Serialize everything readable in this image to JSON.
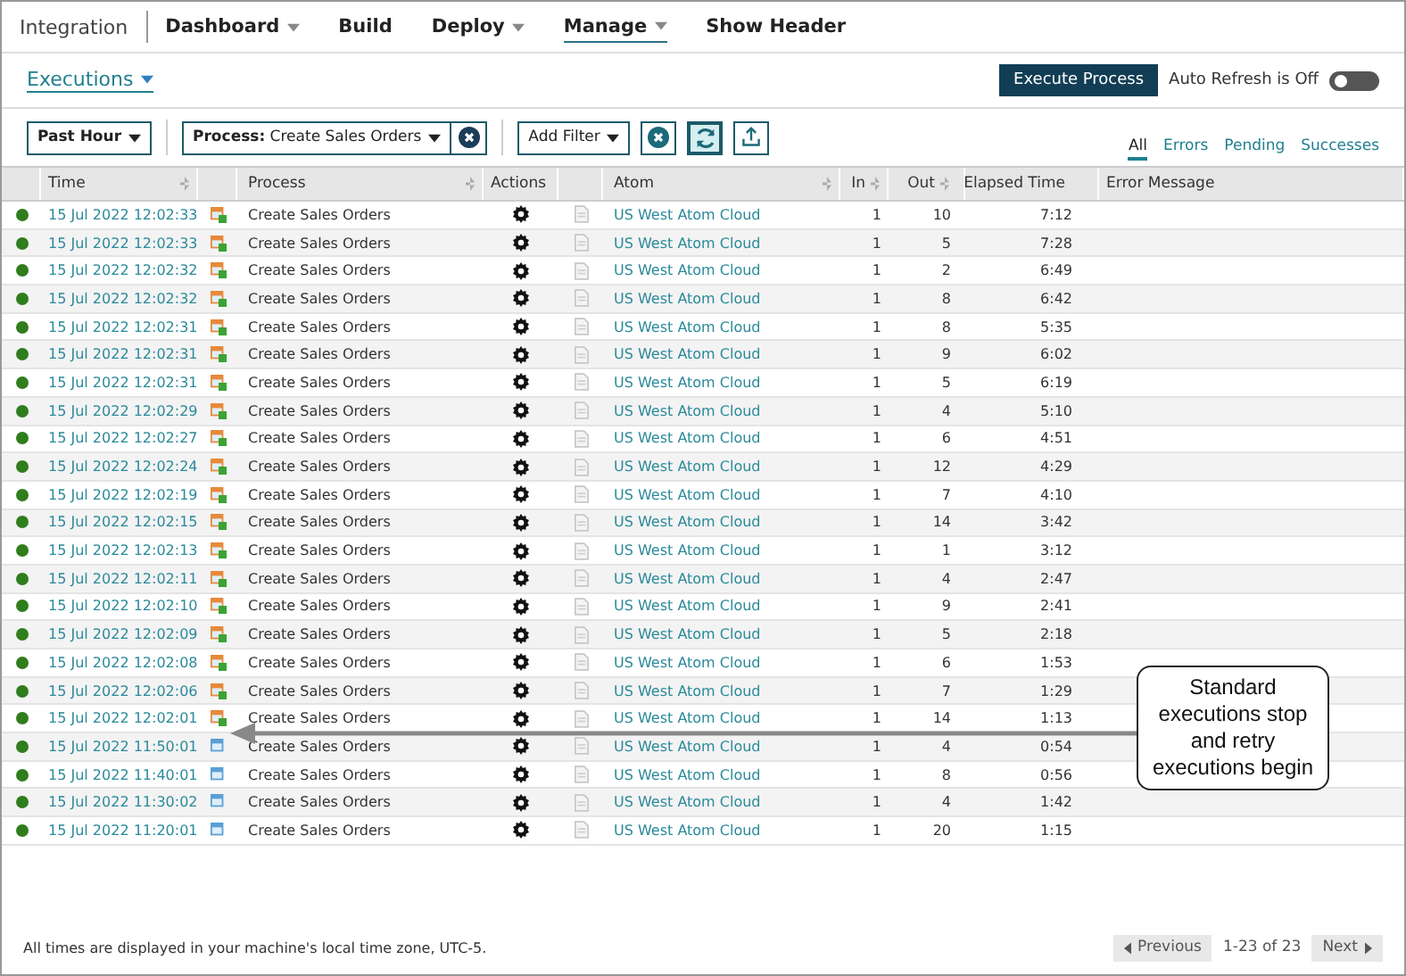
{
  "nav": {
    "brand": "Integration",
    "items": [
      {
        "label": "Dashboard",
        "dropdown": true,
        "selected": false
      },
      {
        "label": "Build",
        "dropdown": false,
        "selected": false
      },
      {
        "label": "Deploy",
        "dropdown": true,
        "selected": false
      },
      {
        "label": "Manage",
        "dropdown": true,
        "selected": true
      },
      {
        "label": "Show Header",
        "dropdown": false,
        "selected": false
      }
    ]
  },
  "page": {
    "title": "Executions",
    "execute_button": "Execute Process",
    "auto_refresh": {
      "label": "Auto Refresh is Off",
      "on": false
    }
  },
  "filters": {
    "time": "Past Hour",
    "process_label": "Process:",
    "process_value": "Create Sales Orders",
    "add_filter": "Add Filter"
  },
  "view_tabs": [
    {
      "label": "All",
      "selected": true
    },
    {
      "label": "Errors",
      "selected": false
    },
    {
      "label": "Pending",
      "selected": false
    },
    {
      "label": "Successes",
      "selected": false
    }
  ],
  "table": {
    "columns": [
      "Time",
      "Process",
      "Actions",
      "Atom",
      "In",
      "Out",
      "Elapsed Time",
      "Error Message"
    ],
    "rows": [
      {
        "time": "15 Jul 2022 12:02:33",
        "retry": true,
        "process": "Create Sales Orders",
        "atom": "US West Atom Cloud",
        "in": "1",
        "out": "10",
        "elapsed": "7:12"
      },
      {
        "time": "15 Jul 2022 12:02:33",
        "retry": true,
        "process": "Create Sales Orders",
        "atom": "US West Atom Cloud",
        "in": "1",
        "out": "5",
        "elapsed": "7:28"
      },
      {
        "time": "15 Jul 2022 12:02:32",
        "retry": true,
        "process": "Create Sales Orders",
        "atom": "US West Atom Cloud",
        "in": "1",
        "out": "2",
        "elapsed": "6:49"
      },
      {
        "time": "15 Jul 2022 12:02:32",
        "retry": true,
        "process": "Create Sales Orders",
        "atom": "US West Atom Cloud",
        "in": "1",
        "out": "8",
        "elapsed": "6:42"
      },
      {
        "time": "15 Jul 2022 12:02:31",
        "retry": true,
        "process": "Create Sales Orders",
        "atom": "US West Atom Cloud",
        "in": "1",
        "out": "8",
        "elapsed": "5:35"
      },
      {
        "time": "15 Jul 2022 12:02:31",
        "retry": true,
        "process": "Create Sales Orders",
        "atom": "US West Atom Cloud",
        "in": "1",
        "out": "9",
        "elapsed": "6:02"
      },
      {
        "time": "15 Jul 2022 12:02:31",
        "retry": true,
        "process": "Create Sales Orders",
        "atom": "US West Atom Cloud",
        "in": "1",
        "out": "5",
        "elapsed": "6:19"
      },
      {
        "time": "15 Jul 2022 12:02:29",
        "retry": true,
        "process": "Create Sales Orders",
        "atom": "US West Atom Cloud",
        "in": "1",
        "out": "4",
        "elapsed": "5:10"
      },
      {
        "time": "15 Jul 2022 12:02:27",
        "retry": true,
        "process": "Create Sales Orders",
        "atom": "US West Atom Cloud",
        "in": "1",
        "out": "6",
        "elapsed": "4:51"
      },
      {
        "time": "15 Jul 2022 12:02:24",
        "retry": true,
        "process": "Create Sales Orders",
        "atom": "US West Atom Cloud",
        "in": "1",
        "out": "12",
        "elapsed": "4:29"
      },
      {
        "time": "15 Jul 2022 12:02:19",
        "retry": true,
        "process": "Create Sales Orders",
        "atom": "US West Atom Cloud",
        "in": "1",
        "out": "7",
        "elapsed": "4:10"
      },
      {
        "time": "15 Jul 2022 12:02:15",
        "retry": true,
        "process": "Create Sales Orders",
        "atom": "US West Atom Cloud",
        "in": "1",
        "out": "14",
        "elapsed": "3:42"
      },
      {
        "time": "15 Jul 2022 12:02:13",
        "retry": true,
        "process": "Create Sales Orders",
        "atom": "US West Atom Cloud",
        "in": "1",
        "out": "1",
        "elapsed": "3:12"
      },
      {
        "time": "15 Jul 2022 12:02:11",
        "retry": true,
        "process": "Create Sales Orders",
        "atom": "US West Atom Cloud",
        "in": "1",
        "out": "4",
        "elapsed": "2:47"
      },
      {
        "time": "15 Jul 2022 12:02:10",
        "retry": true,
        "process": "Create Sales Orders",
        "atom": "US West Atom Cloud",
        "in": "1",
        "out": "9",
        "elapsed": "2:41"
      },
      {
        "time": "15 Jul 2022 12:02:09",
        "retry": true,
        "process": "Create Sales Orders",
        "atom": "US West Atom Cloud",
        "in": "1",
        "out": "5",
        "elapsed": "2:18"
      },
      {
        "time": "15 Jul 2022 12:02:08",
        "retry": true,
        "process": "Create Sales Orders",
        "atom": "US West Atom Cloud",
        "in": "1",
        "out": "6",
        "elapsed": "1:53"
      },
      {
        "time": "15 Jul 2022 12:02:06",
        "retry": true,
        "process": "Create Sales Orders",
        "atom": "US West Atom Cloud",
        "in": "1",
        "out": "7",
        "elapsed": "1:29"
      },
      {
        "time": "15 Jul 2022 12:02:01",
        "retry": true,
        "process": "Create Sales Orders",
        "atom": "US West Atom Cloud",
        "in": "1",
        "out": "14",
        "elapsed": "1:13"
      },
      {
        "time": "15 Jul 2022 11:50:01",
        "retry": false,
        "process": "Create Sales Orders",
        "atom": "US West Atom Cloud",
        "in": "1",
        "out": "4",
        "elapsed": "0:54"
      },
      {
        "time": "15 Jul 2022 11:40:01",
        "retry": false,
        "process": "Create Sales Orders",
        "atom": "US West Atom Cloud",
        "in": "1",
        "out": "8",
        "elapsed": "0:56"
      },
      {
        "time": "15 Jul 2022 11:30:02",
        "retry": false,
        "process": "Create Sales Orders",
        "atom": "US West Atom Cloud",
        "in": "1",
        "out": "4",
        "elapsed": "1:42"
      },
      {
        "time": "15 Jul 2022 11:20:01",
        "retry": false,
        "process": "Create Sales Orders",
        "atom": "US West Atom Cloud",
        "in": "1",
        "out": "20",
        "elapsed": "1:15"
      }
    ]
  },
  "footer": {
    "note": "All times are displayed in your machine's local time zone, UTC-5.",
    "previous": "Previous",
    "range": "1-23 of 23",
    "next": "Next"
  },
  "callout": {
    "text": "Standard executions stop and retry executions begin"
  }
}
